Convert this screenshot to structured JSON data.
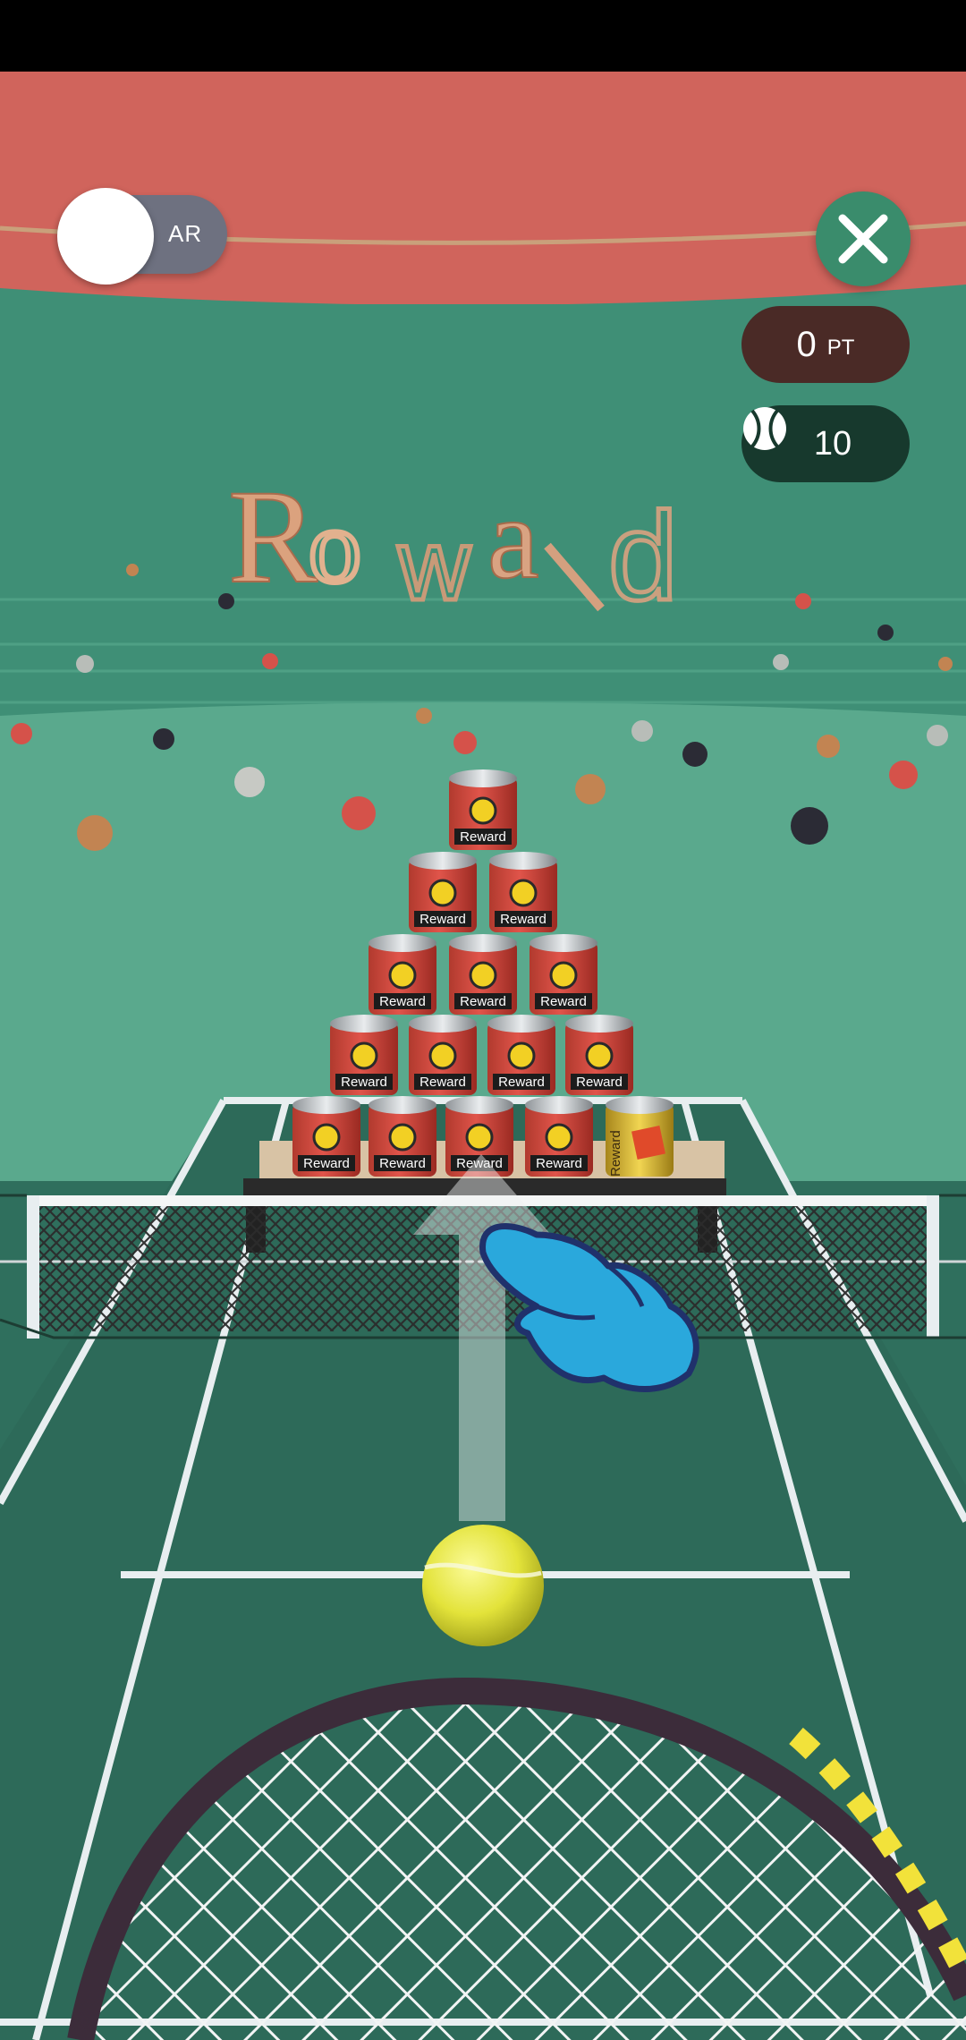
{
  "hud": {
    "ar_toggle_label": "AR",
    "score_value": "0",
    "score_unit": "PT",
    "balls_remaining": "10"
  },
  "scene": {
    "wall_text": "Reward",
    "can_label": "Reward"
  },
  "colors": {
    "wall_top": "#d0645c",
    "wall_green": "#3f8f76",
    "court": "#2f6f5d",
    "court_lines": "#e8eef0",
    "ball": "#e8e84a",
    "hand": "#2aa8dc"
  },
  "icons": {
    "close": "close-icon",
    "ball": "tennis-ball-icon",
    "tutorial": "swipe-hand-icon"
  }
}
